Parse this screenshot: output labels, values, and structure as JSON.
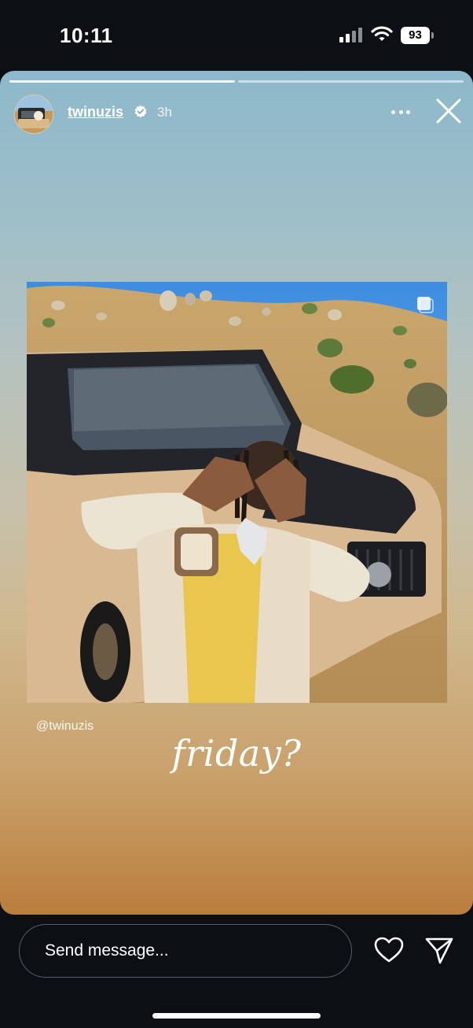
{
  "status_bar": {
    "time": "10:11",
    "battery": "93"
  },
  "story": {
    "username": "twinuzis",
    "verified": true,
    "time_ago": "3h",
    "progress_segments": 2,
    "mention": "@twinuzis",
    "caption": "friday?"
  },
  "composer": {
    "placeholder": "Send message..."
  },
  "icons": [
    "signal-icon",
    "wifi-icon",
    "battery-icon",
    "verified-badge-icon",
    "more-icon",
    "close-icon",
    "heart-icon",
    "send-icon"
  ],
  "colors": {
    "background": "#0c0f14",
    "story_top": "#8db8cb",
    "story_bottom": "#b97e3d"
  }
}
